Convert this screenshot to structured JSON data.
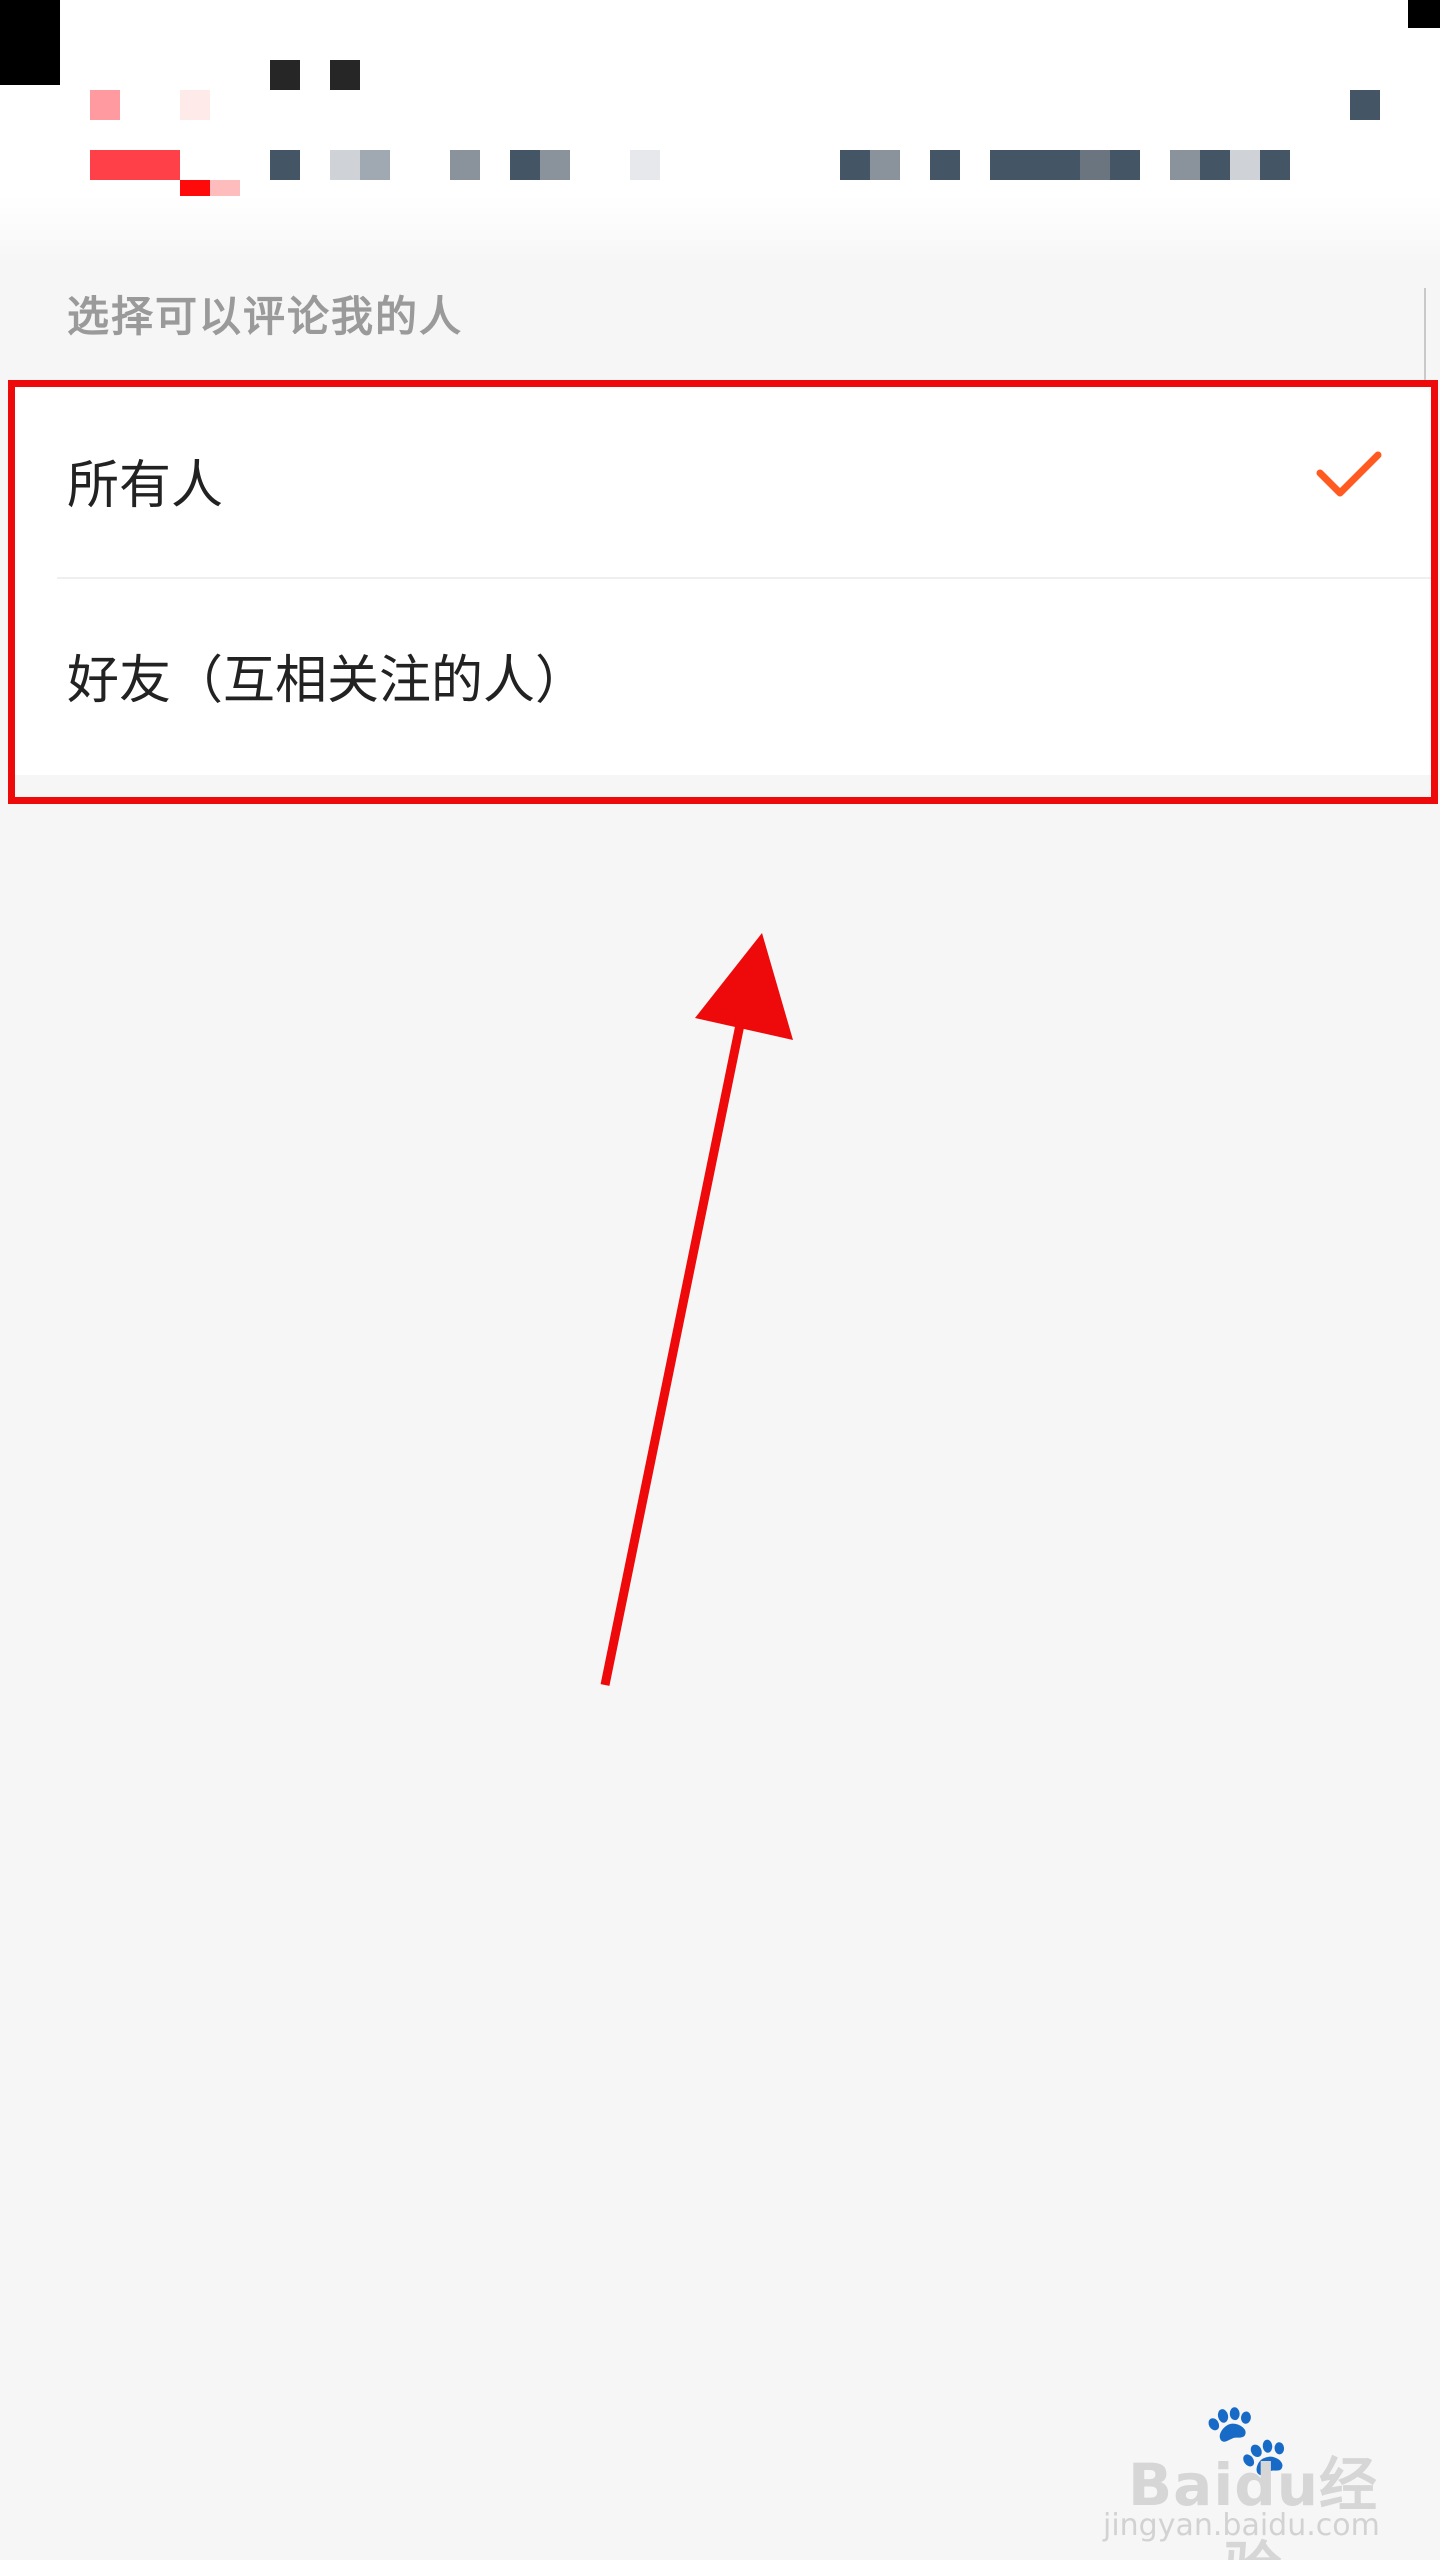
{
  "section": {
    "label": "选择可以评论我的人"
  },
  "options": [
    {
      "label": "所有人",
      "selected": true
    },
    {
      "label": "好友（互相关注的人）",
      "selected": false
    }
  ],
  "colors": {
    "accent_check": "#ff5a1f",
    "annotation_red": "#ee0a0a",
    "background": "#f6f6f7"
  },
  "icons": {
    "check": "check-icon",
    "arrow": "annotation-arrow"
  },
  "watermark": {
    "brand_a": "Bai",
    "brand_b": "du",
    "brand_c": "经验",
    "url": "jingyan.baidu.com"
  }
}
